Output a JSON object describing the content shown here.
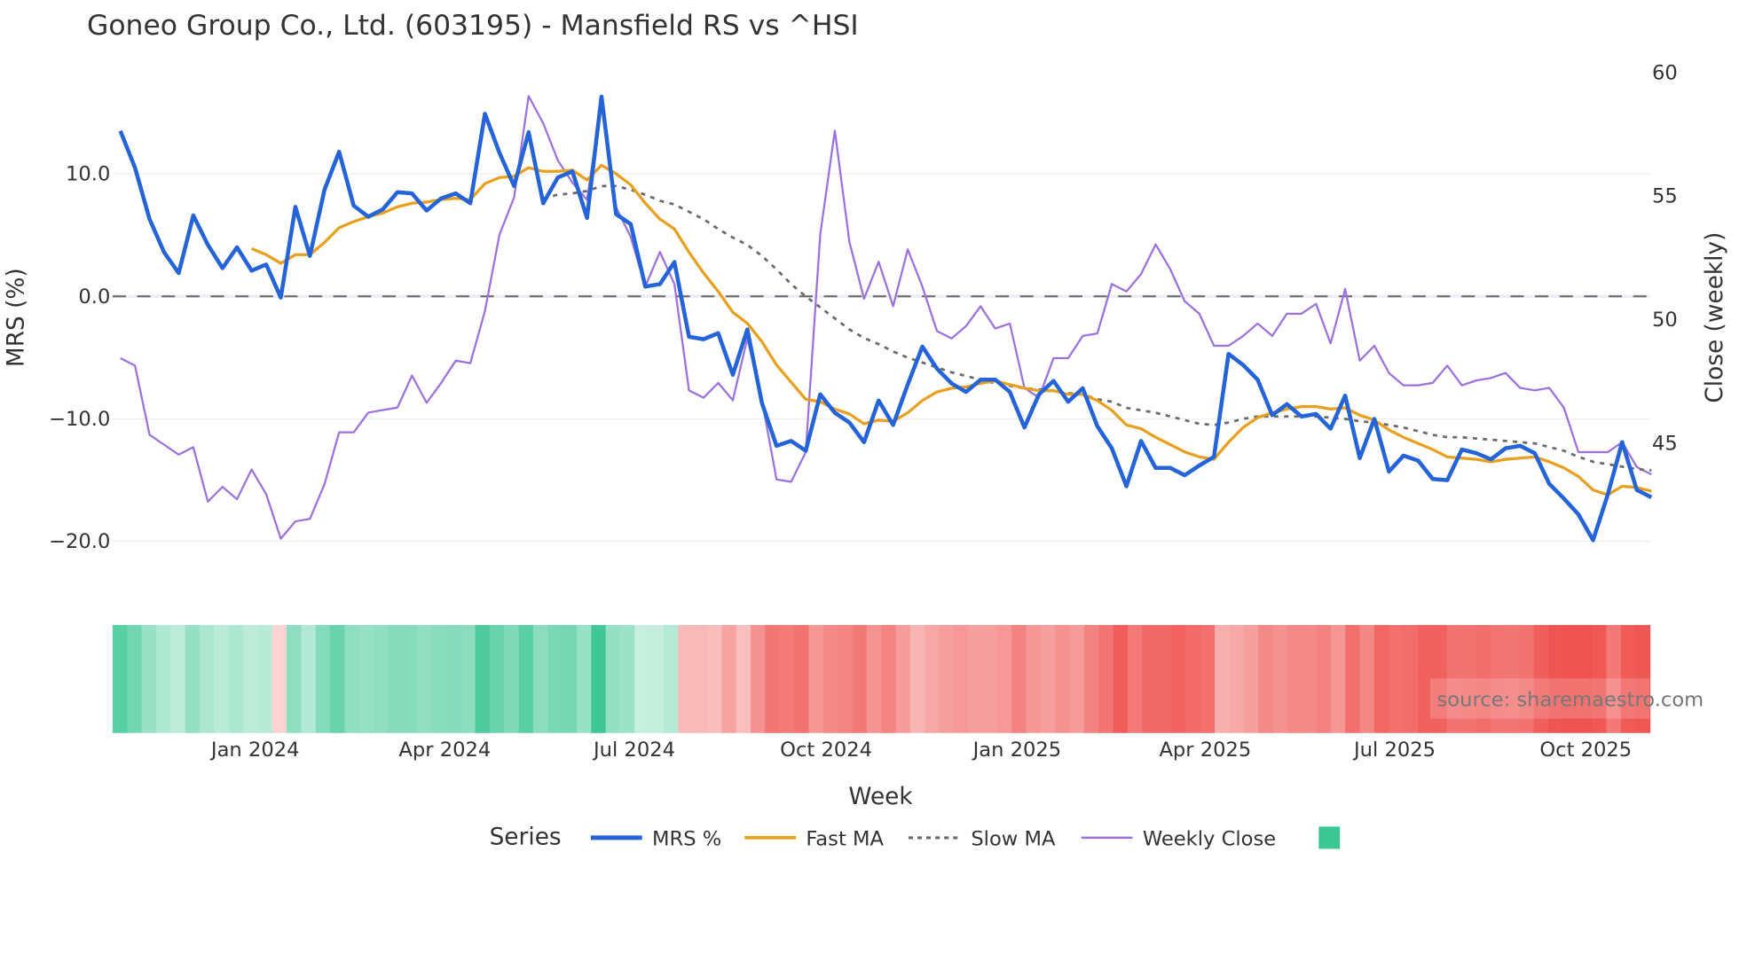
{
  "chart_data": {
    "type": "line",
    "title": "Goneo Group Co., Ltd. (603195) - Mansfield RS vs ^HSI",
    "xlabel": "Week",
    "ylabel": "MRS (%)",
    "y2label": "Close (weekly)",
    "ylim": [
      -23.5,
      19.5
    ],
    "y2lim": [
      40,
      62
    ],
    "y_ticks": [
      "10.0",
      "0.0",
      "−10.0",
      "−20.0"
    ],
    "y_tick_values": [
      10,
      0,
      -10,
      -20
    ],
    "y2_ticks": [
      "60",
      "55",
      "50",
      "45"
    ],
    "y2_tick_values": [
      60,
      55,
      50,
      45
    ],
    "x_ticks": [
      "Jan 2024",
      "Apr 2024",
      "Jul 2024",
      "Oct 2024",
      "Jan 2025",
      "Apr 2025",
      "Jul 2025",
      "Oct 2025"
    ],
    "x_tick_week_index": [
      9.25,
      22.25,
      35.25,
      48.4,
      61.5,
      74.4,
      87.4,
      100.5
    ],
    "grid": true,
    "legend": {
      "title": "Series",
      "position": "bottom-center",
      "entries": [
        "MRS %",
        "Fast MA",
        "Slow MA",
        "Weekly Close"
      ]
    },
    "watermark": "source: sharemaestro.com",
    "colors": {
      "mrs": "#2563d9",
      "fast": "#e8a020",
      "slow": "#6b6b6b",
      "close": "#9b72de",
      "pos": "#3cc694",
      "neg": "#ef5350",
      "zero": "#666666"
    },
    "series": [
      {
        "name": "MRS %",
        "axis": "y",
        "start": 0,
        "values": [
          13.5,
          10.5,
          6.3,
          3.6,
          1.9,
          6.6,
          4.2,
          2.3,
          4.0,
          2.1,
          2.6,
          -0.1,
          7.3,
          3.3,
          8.7,
          11.8,
          7.4,
          6.5,
          7.1,
          8.5,
          8.4,
          7.0,
          8.0,
          8.4,
          7.6,
          14.9,
          11.7,
          9.0,
          13.4,
          7.6,
          9.7,
          10.2,
          6.4,
          16.3,
          6.7,
          5.9,
          0.8,
          1.0,
          2.8,
          -3.3,
          -3.5,
          -3.0,
          -6.4,
          -2.7,
          -8.7,
          -12.2,
          -11.8,
          -12.6,
          -8.0,
          -9.5,
          -10.3,
          -11.9,
          -8.5,
          -10.5,
          -7.2,
          -4.1,
          -5.9,
          -7.1,
          -7.8,
          -6.8,
          -6.8,
          -7.8,
          -10.7,
          -8.0,
          -6.9,
          -8.6,
          -7.5,
          -10.6,
          -12.4,
          -15.5,
          -11.8,
          -14.0,
          -14.0,
          -14.6,
          -13.8,
          -13.1,
          -4.7,
          -5.6,
          -6.8,
          -9.7,
          -8.8,
          -9.8,
          -9.6,
          -10.8,
          -8.1,
          -13.2,
          -10.0,
          -14.3,
          -13.0,
          -13.4,
          -14.9,
          -15.0,
          -12.5,
          -12.8,
          -13.3,
          -12.4,
          -12.2,
          -12.8,
          -15.3,
          -16.5,
          -17.8,
          -19.9,
          -16.2,
          -11.9,
          -15.8,
          -16.4
        ]
      },
      {
        "name": "Fast MA",
        "axis": "y",
        "start": 9,
        "values": [
          3.9,
          3.4,
          2.7,
          3.4,
          3.4,
          4.4,
          5.6,
          6.1,
          6.5,
          6.8,
          7.3,
          7.6,
          7.7,
          7.9,
          8.0,
          7.9,
          9.2,
          9.7,
          9.8,
          10.5,
          10.2,
          10.2,
          10.3,
          9.5,
          10.7,
          10.0,
          9.1,
          7.6,
          6.3,
          5.5,
          3.6,
          1.9,
          0.4,
          -1.3,
          -2.2,
          -3.7,
          -5.6,
          -7.0,
          -8.4,
          -8.6,
          -9.2,
          -9.6,
          -10.4,
          -10.1,
          -10.2,
          -9.5,
          -8.5,
          -7.8,
          -7.5,
          -7.4,
          -7.1,
          -6.9,
          -7.2,
          -7.5,
          -7.7,
          -7.7,
          -8.0,
          -8.0,
          -8.5,
          -9.3,
          -10.5,
          -10.8,
          -11.5,
          -12.1,
          -12.7,
          -13.1,
          -13.3,
          -11.9,
          -10.7,
          -9.9,
          -9.5,
          -9.2,
          -9.0,
          -9.0,
          -9.2,
          -9.1,
          -9.7,
          -10.1,
          -10.9,
          -11.5,
          -12.0,
          -12.5,
          -13.1,
          -13.2,
          -13.3,
          -13.5,
          -13.3,
          -13.2,
          -13.1,
          -13.5,
          -14.0,
          -14.7,
          -15.8,
          -16.2,
          -15.5,
          -15.6,
          -15.9
        ]
      },
      {
        "name": "Slow MA",
        "axis": "y",
        "start": 29,
        "values": [
          8.0,
          8.3,
          8.4,
          8.6,
          9.0,
          9.0,
          8.7,
          8.3,
          7.8,
          7.5,
          6.9,
          6.3,
          5.5,
          4.8,
          4.2,
          3.3,
          2.2,
          1.0,
          0.0,
          -0.9,
          -1.8,
          -2.7,
          -3.4,
          -3.9,
          -4.5,
          -5.0,
          -5.4,
          -5.8,
          -6.2,
          -6.5,
          -6.8,
          -7.1,
          -7.3,
          -7.5,
          -7.6,
          -7.7,
          -7.9,
          -8.0,
          -8.4,
          -8.6,
          -9.1,
          -9.3,
          -9.5,
          -9.8,
          -10.1,
          -10.4,
          -10.5,
          -10.3,
          -10.0,
          -9.8,
          -9.8,
          -9.8,
          -9.8,
          -9.8,
          -9.9,
          -10.0,
          -10.2,
          -10.3,
          -10.5,
          -10.7,
          -11.0,
          -11.3,
          -11.5,
          -11.5,
          -11.6,
          -11.7,
          -11.8,
          -11.9,
          -12.0,
          -12.3,
          -12.6,
          -13.1,
          -13.5,
          -13.7,
          -13.9,
          -14.1,
          -14.2
        ]
      },
      {
        "name": "Weekly Close",
        "axis": "y2",
        "start": 0,
        "values": [
          48.4,
          48.1,
          45.3,
          44.9,
          44.5,
          44.8,
          42.6,
          43.2,
          42.7,
          43.9,
          42.9,
          41.1,
          41.8,
          41.9,
          43.3,
          45.4,
          45.4,
          46.2,
          46.3,
          46.4,
          47.7,
          46.6,
          47.4,
          48.3,
          48.2,
          50.3,
          53.4,
          54.9,
          59.0,
          57.9,
          56.4,
          55.5,
          54.8,
          58.8,
          54.5,
          53.3,
          51.3,
          52.7,
          51.4,
          47.1,
          46.8,
          47.4,
          46.7,
          49.2,
          46.7,
          43.5,
          43.4,
          44.6,
          53.4,
          57.6,
          53.1,
          50.8,
          52.3,
          50.5,
          52.8,
          51.3,
          49.5,
          49.2,
          49.7,
          50.5,
          49.6,
          49.8,
          47.2,
          46.8,
          48.4,
          48.4,
          49.3,
          49.4,
          51.4,
          51.1,
          51.8,
          53.0,
          52.0,
          50.7,
          50.2,
          48.9,
          48.9,
          49.3,
          49.8,
          49.3,
          50.2,
          50.2,
          50.6,
          49.0,
          51.2,
          48.3,
          48.9,
          47.8,
          47.3,
          47.3,
          47.4,
          48.1,
          47.3,
          47.5,
          47.6,
          47.8,
          47.2,
          47.1,
          47.2,
          46.4,
          44.6,
          44.6,
          44.6,
          45.0,
          44.0,
          43.7
        ]
      }
    ]
  }
}
